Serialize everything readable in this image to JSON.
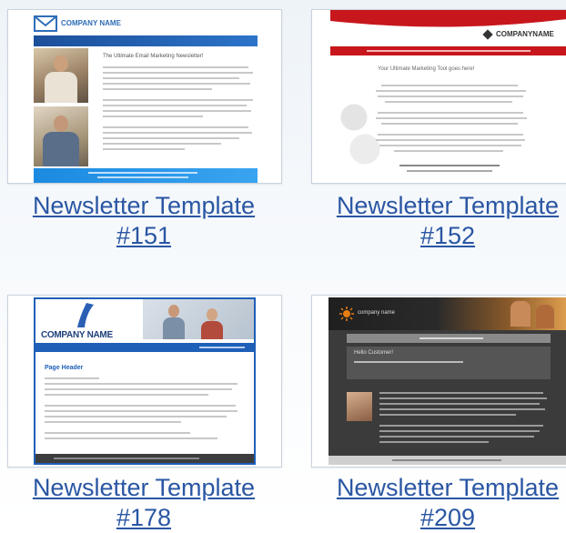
{
  "templates": [
    {
      "title": "Newsletter Template",
      "number": "#151",
      "preview": {
        "brand": "COMPANY NAME",
        "headline": "The Ultimate Email Marketing Newsletter!"
      }
    },
    {
      "title": "Newsletter Template",
      "number": "#152",
      "preview": {
        "brand": "COMPANYNAME",
        "headline": "Your Ultimate Marketing Tool goes here!"
      }
    },
    {
      "title": "Newsletter Template",
      "number": "#178",
      "preview": {
        "brand": "COMPANY NAME",
        "heading": "Page Header"
      }
    },
    {
      "title": "Newsletter Template",
      "number": "#209",
      "preview": {
        "brand": "company name",
        "heading": "Hello Customer!"
      }
    }
  ],
  "colors": {
    "link": "#2a56a3",
    "blue_bar": "#1e5fb8",
    "red_header": "#c8161d",
    "dark_bg": "#3b3b3b",
    "orange": "#e67e12"
  }
}
